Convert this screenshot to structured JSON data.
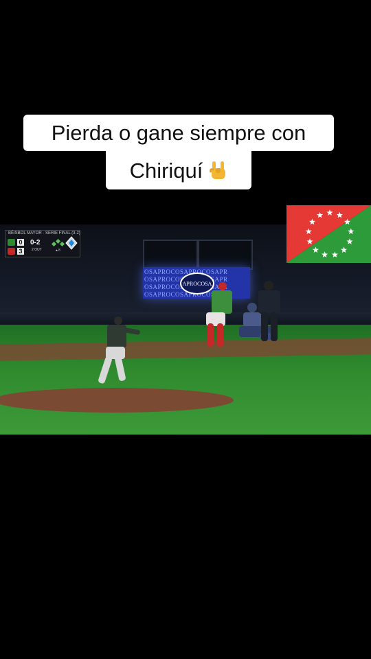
{
  "caption": {
    "line1": "Pierda o gane  siempre con",
    "line2": "Chiriquí",
    "emoji_icon": "rock-on-hand-icon"
  },
  "scoreboard": {
    "title": "BÉISBOL MAYOR · SERIE FINAL (3-2)",
    "away_score": "0",
    "home_score": "3",
    "count": "0-2",
    "outs": "2 OUT",
    "inning_tag": "▲8",
    "away_logo_color": "#2e8b2e",
    "home_logo_color": "#c62828"
  },
  "video": {
    "ad_text": "OSAPROCOSAPROCOSAPR",
    "ad_logo": "APROCOSA"
  },
  "flag": {
    "red": "#e53935",
    "green": "#2e9b3a",
    "star_color": "#ffffff"
  }
}
